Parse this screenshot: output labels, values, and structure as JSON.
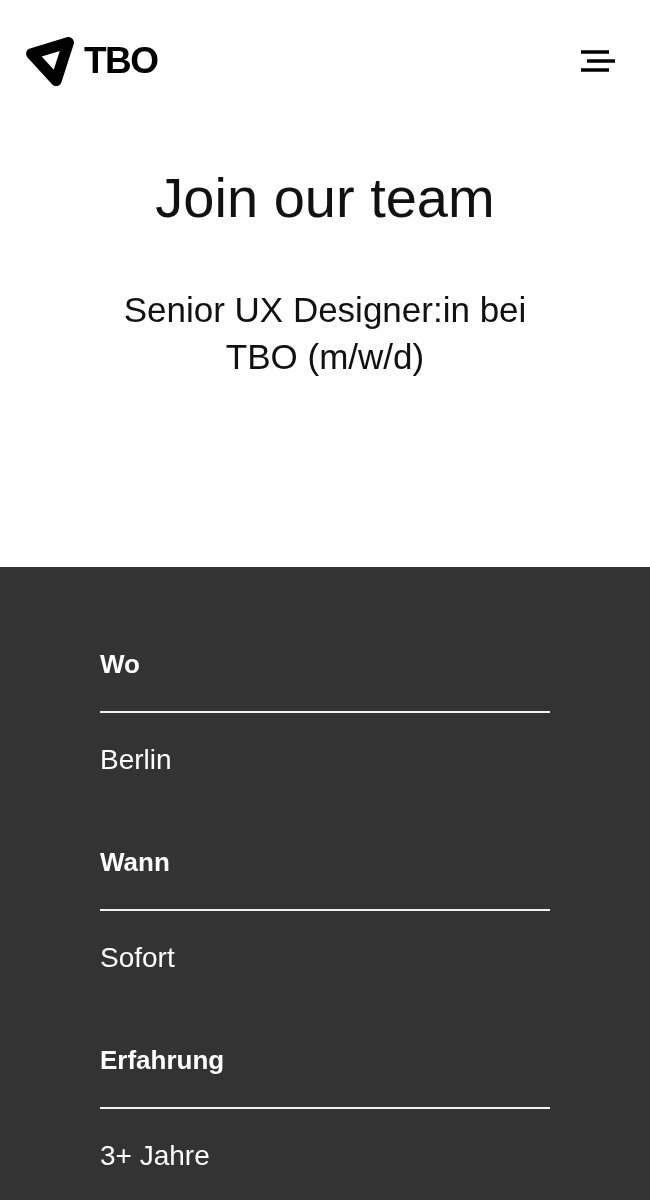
{
  "header": {
    "logo_text": "TBO"
  },
  "hero": {
    "title": "Join our team",
    "subtitle": "Senior UX Designer:in bei TBO (m/w/d)"
  },
  "details": [
    {
      "label": "Wo",
      "value": "Berlin"
    },
    {
      "label": "Wann",
      "value": "Sofort"
    },
    {
      "label": "Erfahrung",
      "value": "3+ Jahre"
    }
  ]
}
